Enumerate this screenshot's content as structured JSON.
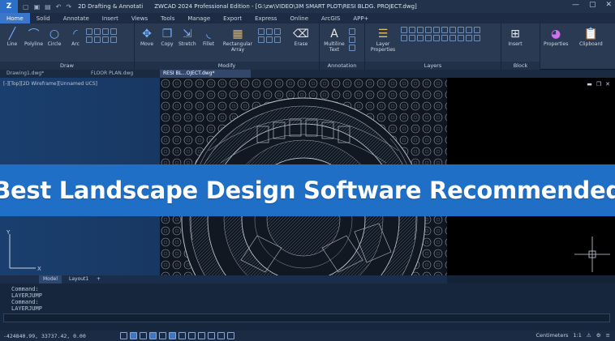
{
  "titlebar": {
    "workspace": "2D Drafting & Annotati",
    "doc_title": "ZWCAD 2024 Professional Edition - [G:\\zw\\VIDEO\\3M SMART PLOT\\RESI BLDG. PROJECT.dwg]"
  },
  "menu": [
    "Home",
    "Solid",
    "Annotate",
    "Insert",
    "Views",
    "Tools",
    "Manage",
    "Export",
    "Express",
    "Online",
    "ArcGIS",
    "APP+"
  ],
  "ribbon": {
    "draw": {
      "label": "Draw",
      "tools": [
        "Line",
        "Polyline",
        "Circle",
        "Arc"
      ]
    },
    "modify": {
      "label": "Modify",
      "tools": [
        "Move",
        "Copy",
        "Stretch",
        "Fillet",
        "Rectangular Array",
        "Erase"
      ]
    },
    "annotation": {
      "label": "Annotation",
      "tools": [
        "Multiline Text"
      ]
    },
    "layers": {
      "label": "Layers",
      "tools": [
        "Layer Properties"
      ],
      "current_layer": "0"
    },
    "block": {
      "label": "Block",
      "tools": [
        "Insert"
      ]
    },
    "extra": [
      "Properties",
      "Clipboard"
    ]
  },
  "doc_tabs": [
    "Drawing1.dwg*",
    "FLOOR PLAN.dwg",
    "RESI BL...OJECT.dwg*"
  ],
  "view_label": "[-][Top][2D Wireframe][Unnamed UCS]",
  "banner": {
    "text": "Best Landscape Design Software Recommended"
  },
  "layout_tabs": [
    "Model",
    "Layout1",
    "+"
  ],
  "command_lines": [
    "Command:",
    "LAYERJUMP",
    "Command:",
    "LAYERJUMP"
  ],
  "status": {
    "coords": "-424840.99, 33737.42, 0.00",
    "units": "Centimeters",
    "scale": "1:1"
  },
  "colors": {
    "accent": "#1f6fc7",
    "ribbon": "#2a3a53",
    "canvas_dark": "#000000"
  }
}
